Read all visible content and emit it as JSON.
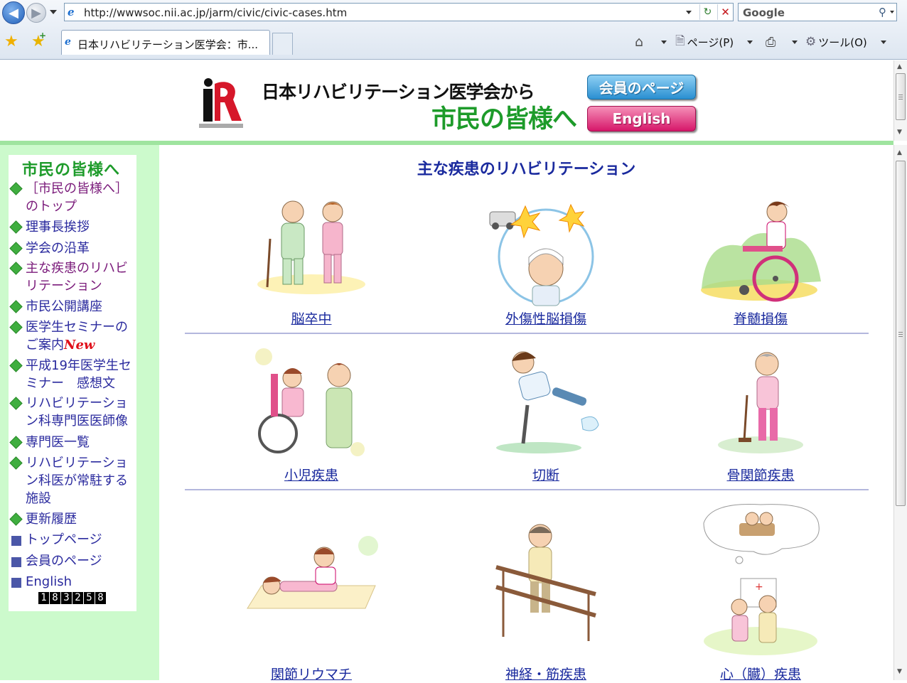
{
  "browser": {
    "url": "http://wwwsoc.nii.ac.jp/jarm/civic/civic-cases.htm",
    "search_placeholder": "Google",
    "tab_title": "日本リハビリテーション医学会：市...",
    "page_menu": "ページ(P)",
    "tools_menu": "ツール(O)"
  },
  "header": {
    "line1": "日本リハビリテーション医学会から",
    "line2": "市民の皆様へ",
    "member_button": "会員のページ",
    "english_button": "English"
  },
  "sidebar": {
    "title": "市民の皆様へ",
    "items": [
      {
        "label": "［市民の皆様へ］のトップ",
        "visited": true
      },
      {
        "label": "理事長挨拶",
        "visited": false
      },
      {
        "label": "学会の沿革",
        "visited": false
      },
      {
        "label": "主な疾患のリハビリテーション",
        "visited": true
      },
      {
        "label": "市民公開講座",
        "visited": false
      },
      {
        "label": "医学生セミナーのご案内",
        "visited": false,
        "badge": "New"
      },
      {
        "label": "平成19年医学生セミナー　感想文",
        "visited": false
      },
      {
        "label": "リハビリテーション科専門医医師像",
        "visited": false
      },
      {
        "label": "専門医一覧",
        "visited": false
      },
      {
        "label": "リハビリテーション科医が常駐する施設",
        "visited": false
      },
      {
        "label": "更新履歴",
        "visited": false
      }
    ],
    "links": [
      "トップページ",
      "会員のページ",
      "English"
    ],
    "counter": [
      "1",
      "8",
      "3",
      "2",
      "5",
      "8"
    ]
  },
  "main": {
    "title": "主な疾患のリハビリテーション",
    "diseases": [
      {
        "label": "脳卒中",
        "icon": "stroke-illustration"
      },
      {
        "label": "外傷性脳損傷",
        "icon": "brain-injury-illustration"
      },
      {
        "label": "脊髄損傷",
        "icon": "spinal-cord-injury-illustration"
      },
      {
        "label": "小児疾患",
        "icon": "pediatric-illustration"
      },
      {
        "label": "切断",
        "icon": "amputation-illustration"
      },
      {
        "label": "骨関節疾患",
        "icon": "bone-joint-illustration"
      },
      {
        "label": "関節リウマチ",
        "icon": "rheumatoid-illustration"
      },
      {
        "label": "神経・筋疾患",
        "icon": "neuromuscular-illustration"
      },
      {
        "label": "心（臓）疾患",
        "icon": "heart-disease-illustration"
      }
    ]
  },
  "colors": {
    "sidebar_bg": "#ccfacc",
    "header_rule": "#9fe49f",
    "link": "#1a2a9e",
    "brand_green": "#1d9b2a",
    "member_blue": "#2a8fd1",
    "english_pink": "#d6176a"
  }
}
